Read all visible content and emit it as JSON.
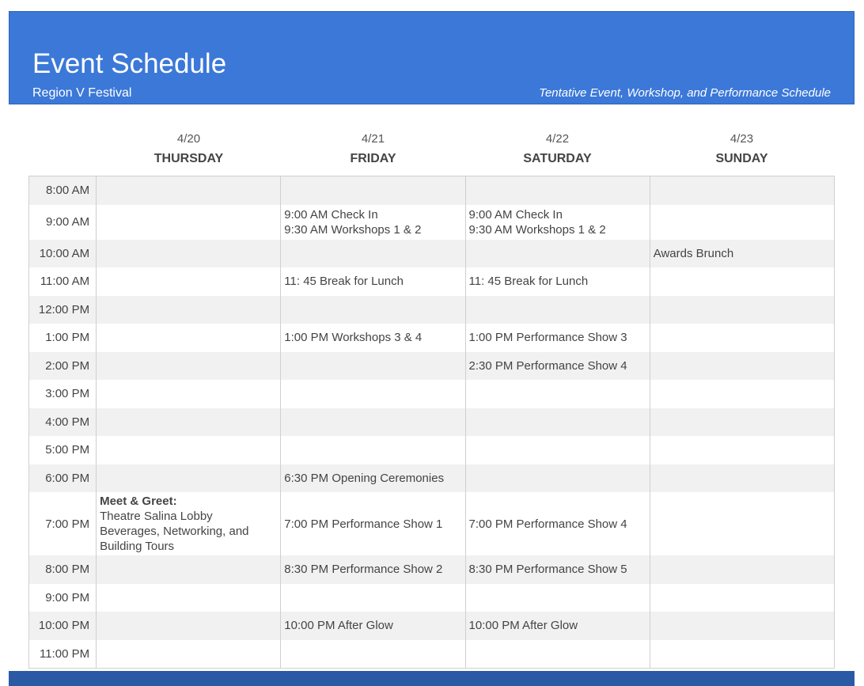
{
  "header": {
    "title": "Event Schedule",
    "subtitle": "Region V Festival",
    "tagline": "Tentative Event, Workshop, and Performance Schedule"
  },
  "days": [
    {
      "date": "4/20",
      "name": "THURSDAY"
    },
    {
      "date": "4/21",
      "name": "FRIDAY"
    },
    {
      "date": "4/22",
      "name": "SATURDAY"
    },
    {
      "date": "4/23",
      "name": "SUNDAY"
    }
  ],
  "rows": [
    {
      "time": "8:00 AM",
      "cells": [
        [],
        [],
        [],
        []
      ]
    },
    {
      "time": "9:00 AM",
      "cells": [
        [],
        [
          "9:00 AM Check In",
          "9:30 AM Workshops 1 & 2"
        ],
        [
          "9:00 AM Check In",
          "9:30 AM Workshops 1 & 2"
        ],
        []
      ]
    },
    {
      "time": "10:00 AM",
      "cells": [
        [],
        [],
        [],
        [
          "Awards Brunch"
        ]
      ]
    },
    {
      "time": "11:00 AM",
      "cells": [
        [],
        [
          "11: 45 Break for Lunch"
        ],
        [
          "11: 45 Break for Lunch"
        ],
        []
      ]
    },
    {
      "time": "12:00 PM",
      "cells": [
        [],
        [],
        [],
        []
      ]
    },
    {
      "time": "1:00 PM",
      "cells": [
        [],
        [
          "1:00 PM Workshops 3 & 4"
        ],
        [
          "1:00 PM Performance Show 3"
        ],
        []
      ]
    },
    {
      "time": "2:00 PM",
      "cells": [
        [],
        [],
        [
          "2:30 PM Performance Show 4"
        ],
        []
      ]
    },
    {
      "time": "3:00 PM",
      "cells": [
        [],
        [],
        [],
        []
      ]
    },
    {
      "time": "4:00 PM",
      "cells": [
        [],
        [],
        [],
        []
      ]
    },
    {
      "time": "5:00 PM",
      "cells": [
        [],
        [],
        [],
        []
      ]
    },
    {
      "time": "6:00 PM",
      "cells": [
        [],
        [
          "6:30 PM Opening Ceremonies"
        ],
        [],
        []
      ]
    },
    {
      "time": "7:00 PM",
      "cells": [
        [
          "Meet & Greet:",
          "Theatre Salina Lobby",
          "Beverages, Networking, and",
          "Building Tours"
        ],
        [
          "7:00 PM Performance Show 1"
        ],
        [
          "7:00 PM Performance Show 4"
        ],
        []
      ]
    },
    {
      "time": "8:00 PM",
      "cells": [
        [],
        [
          "8:30 PM Performance Show 2"
        ],
        [
          "8:30 PM Performance Show 5"
        ],
        []
      ]
    },
    {
      "time": "9:00 PM",
      "cells": [
        [],
        [],
        [],
        []
      ]
    },
    {
      "time": "10:00 PM",
      "cells": [
        [],
        [
          "10:00 PM After Glow"
        ],
        [
          "10:00 PM After Glow"
        ],
        []
      ]
    },
    {
      "time": "11:00 PM",
      "cells": [
        [],
        [],
        [],
        []
      ]
    }
  ],
  "colors": {
    "header_bg": "#3b78d8",
    "footer_bar": "#2a5aa3",
    "row_shade": "#f1f1f1",
    "grid_line": "#cfcfcf"
  }
}
